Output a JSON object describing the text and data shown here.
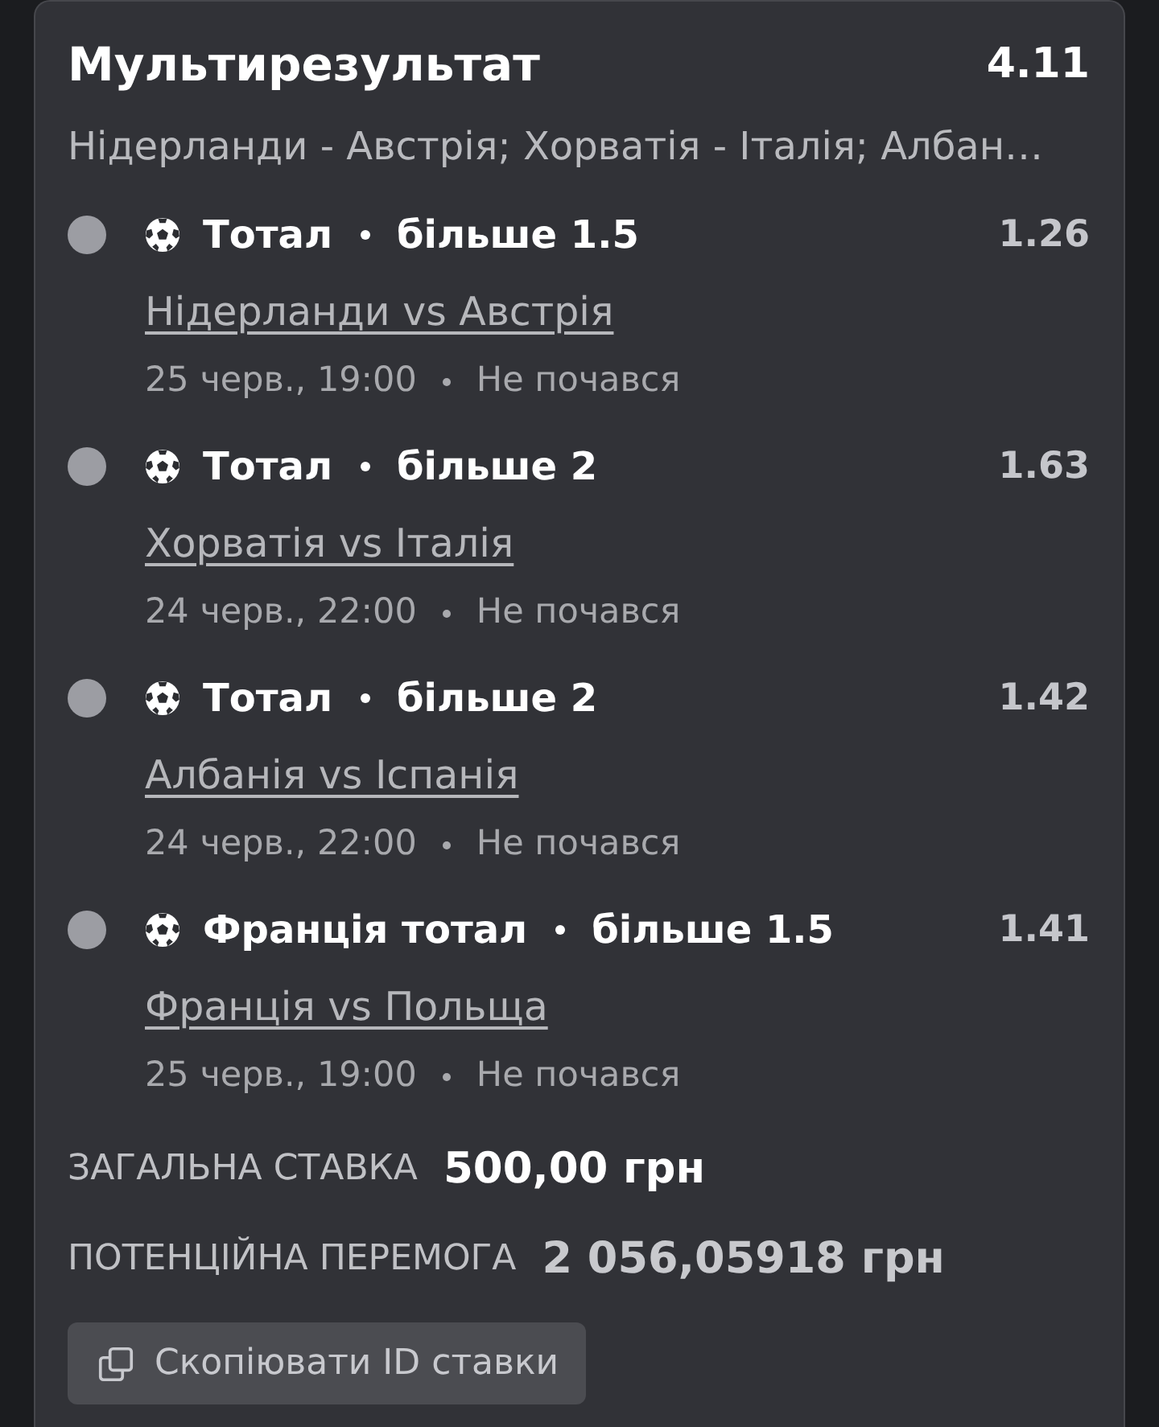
{
  "bet": {
    "title": "Мультирезультат",
    "total_odds": "4.11",
    "summary": "Нідерланди - Австрія; Хорватія - Італія; Албан…"
  },
  "selections": [
    {
      "market": "Тотал",
      "outcome": "більше 1.5",
      "odds": "1.26",
      "match": "Нідерланди vs Австрія",
      "date": "25 черв., 19:00",
      "status": "Не почався"
    },
    {
      "market": "Тотал",
      "outcome": "більше 2",
      "odds": "1.63",
      "match": "Хорватія vs Італія",
      "date": "24 черв., 22:00",
      "status": "Не почався"
    },
    {
      "market": "Тотал",
      "outcome": "більше 2",
      "odds": "1.42",
      "match": "Албанія vs Іспанія",
      "date": "24 черв., 22:00",
      "status": "Не почався"
    },
    {
      "market": "Франція тотал",
      "outcome": "більше 1.5",
      "odds": "1.41",
      "match": "Франція vs Польща",
      "date": "25 черв., 19:00",
      "status": "Не почався"
    }
  ],
  "stake": {
    "label": "ЗАГАЛЬНА СТАВКА",
    "value": "500,00 грн"
  },
  "potential_win": {
    "label": "ПОТЕНЦІЙНА ПЕРЕМОГА",
    "value": "2 056,05918 грн"
  },
  "copy_button": {
    "label": "Скопіювати ID ставки"
  }
}
